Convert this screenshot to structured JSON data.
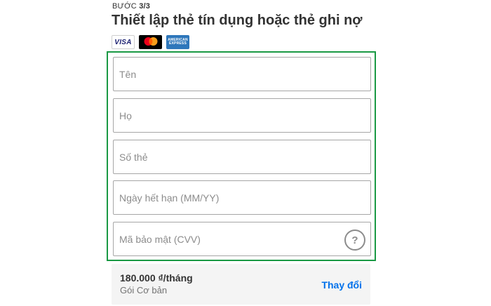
{
  "step": {
    "prefix": "BƯỚC",
    "value": "3/3"
  },
  "title": "Thiết lập thẻ tín dụng hoặc thẻ ghi nợ",
  "card_logos": [
    {
      "name": "visa",
      "label": "VISA"
    },
    {
      "name": "mastercard",
      "label": "mastercard"
    },
    {
      "name": "amex",
      "label": "AMERICAN EXPRESS"
    }
  ],
  "colors": {
    "form_border": "#1a9944",
    "link": "#0071eb"
  },
  "fields": {
    "first_name": {
      "placeholder": "Tên"
    },
    "last_name": {
      "placeholder": "Họ"
    },
    "card_number": {
      "placeholder": "Số thẻ"
    },
    "expiry": {
      "placeholder": "Ngày hết hạn (MM/YY)"
    },
    "cvv": {
      "placeholder": "Mã bảo mật (CVV)",
      "help_icon": "?"
    }
  },
  "plan": {
    "price": "180.000 ₫/tháng",
    "name": "Gói Cơ bản",
    "change_label": "Thay đổi"
  }
}
